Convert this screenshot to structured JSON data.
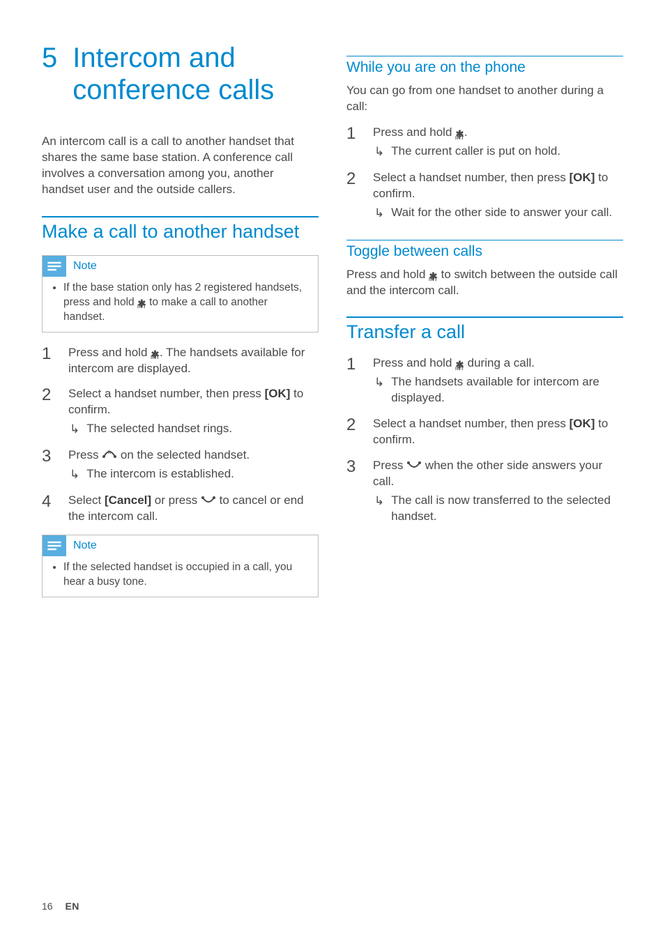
{
  "chapter": {
    "number": "5",
    "title": "Intercom and conference calls"
  },
  "intro": "An intercom call is a call to another handset that shares the same base station. A conference call involves a conversation among you, another handset user and the outside callers.",
  "labels": {
    "note": "Note",
    "ok": "[OK]",
    "cancel": "[Cancel]",
    "int_sub": "INT"
  },
  "left": {
    "section1": {
      "title": "Make a call to another handset",
      "note1": "If the base station only has 2 registered handsets, press and hold {STAR} to make a call to another handset.",
      "steps": [
        {
          "text": "Press and hold {STAR}. The handsets available for intercom are displayed."
        },
        {
          "text": "Select a handset number, then press {OK} to confirm.",
          "result": "The selected handset rings."
        },
        {
          "text": "Press {TALK} on the selected handset.",
          "result": "The intercom is established."
        },
        {
          "text": "Select {CANCEL} or press {END} to cancel or end the intercom call."
        }
      ],
      "note2": "If the selected handset is occupied in a call, you hear a busy tone."
    }
  },
  "right": {
    "sub1": {
      "title": "While you are on the phone",
      "intro": "You can go from one handset to another during a call:",
      "steps": [
        {
          "text": "Press and hold {STAR}.",
          "result": "The current caller is put on hold."
        },
        {
          "text": "Select a handset number, then press {OK} to confirm.",
          "result": "Wait for the other side to answer your call."
        }
      ]
    },
    "sub2": {
      "title": "Toggle between calls",
      "text": "Press and hold {STAR} to switch between the outside call and the intercom call."
    },
    "section2": {
      "title": "Transfer a call",
      "steps": [
        {
          "text": "Press and hold {STAR} during a call.",
          "result": "The handsets available for intercom are displayed."
        },
        {
          "text": "Select a handset number, then press {OK} to confirm."
        },
        {
          "text": "Press {END} when the other side answers your call.",
          "result": "The call is now transferred to the selected handset."
        }
      ]
    }
  },
  "footer": {
    "page": "16",
    "lang": "EN"
  }
}
